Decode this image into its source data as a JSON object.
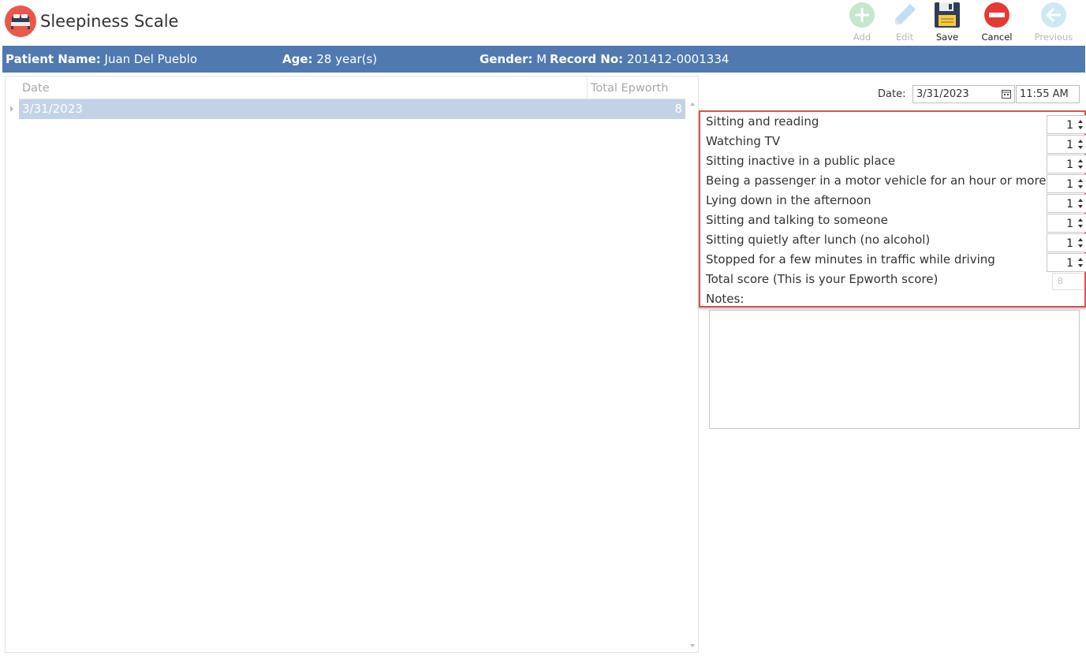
{
  "window": {
    "title": "Sleepiness Scale"
  },
  "toolbar": {
    "add_label": "Add",
    "edit_label": "Edit",
    "save_label": "Save",
    "cancel_label": "Cancel",
    "previous_label": "Previous",
    "icons": {
      "add": "plus-circle-icon",
      "edit": "pencil-icon",
      "save": "floppy-disk-icon",
      "cancel": "minus-circle-icon",
      "previous": "arrow-left-circle-icon"
    }
  },
  "patient": {
    "name_label": "Patient Name:",
    "name_value": "Juan Del Pueblo",
    "age_label": "Age:",
    "age_value": "28 year(s)",
    "gender_label": "Gender:",
    "gender_value": "M",
    "record_label": "Record No:",
    "record_value": "201412-0001334"
  },
  "grid": {
    "columns": [
      "Date",
      "Total Epworth"
    ],
    "rows": [
      {
        "date": "3/31/2023",
        "total": "8"
      }
    ]
  },
  "form": {
    "date_label": "Date:",
    "date_value": "3/31/2023",
    "time_value": "11:55 AM",
    "questions": [
      {
        "label": "Sitting and reading",
        "value": "1"
      },
      {
        "label": "Watching TV",
        "value": "1"
      },
      {
        "label": "Sitting inactive in a public place",
        "value": "1"
      },
      {
        "label": "Being a passenger in a motor vehicle for an hour or more",
        "value": "1"
      },
      {
        "label": "Lying down in the afternoon",
        "value": "1"
      },
      {
        "label": "Sitting and talking to someone",
        "value": "1"
      },
      {
        "label": "Sitting quietly after lunch (no alcohol)",
        "value": "1"
      },
      {
        "label": "Stopped for a few minutes in traffic while driving",
        "value": "1"
      }
    ],
    "total_label": "Total score (This is your Epworth score)",
    "total_value": "8",
    "notes_label": "Notes:",
    "notes_value": ""
  },
  "colors": {
    "patient_bar": "#5079b0",
    "selected_row": "#c3d3e7",
    "highlight_border": "#d9534f",
    "logo": "#e8584a"
  }
}
